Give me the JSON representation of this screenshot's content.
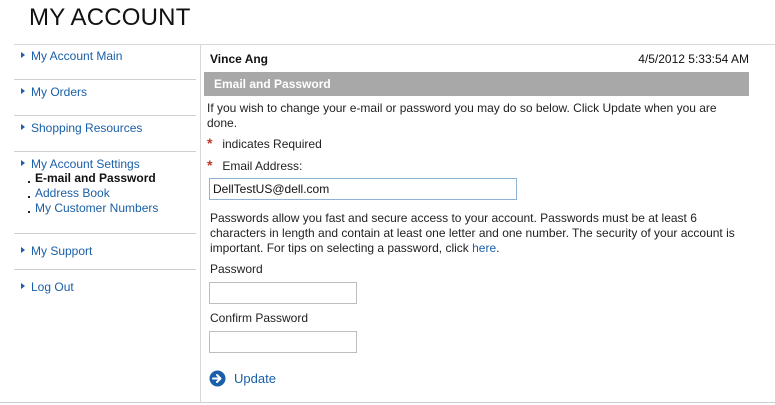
{
  "page": {
    "title": "MY ACCOUNT"
  },
  "sidebar": {
    "items": [
      {
        "label": "My Account Main"
      },
      {
        "label": "My Orders"
      },
      {
        "label": "Shopping Resources"
      },
      {
        "label": "My Account Settings"
      },
      {
        "label": "My Support"
      },
      {
        "label": "Log Out"
      }
    ],
    "settings_subitems": [
      {
        "label": "E-mail and Password",
        "active": true
      },
      {
        "label": "Address Book"
      },
      {
        "label": "My Customer Numbers"
      }
    ]
  },
  "header": {
    "user_name": "Vince Ang",
    "timestamp": "4/5/2012 5:33:54 AM"
  },
  "section": {
    "title": "Email and Password",
    "intro": "If you wish to change your e-mail or password you may do so below. Click Update when you are done.",
    "required_marker": "*",
    "required_note": "indicates Required"
  },
  "form": {
    "email_label": "Email Address:",
    "email_value": "DellTestUS@dell.com",
    "password_info": "Passwords allow you fast and secure access to your account. Passwords must be at least 6 characters in length and contain at least one letter and one number. The security of your account is important. For tips on selecting a password, click",
    "password_info_link": "here",
    "password_info_end": ".",
    "password_label": "Password",
    "confirm_password_label": "Confirm Password",
    "update_label": "Update"
  },
  "colors": {
    "link": "#1a5fa8",
    "section_bar": "#a8a8a8",
    "required_star": "#c0392b"
  }
}
